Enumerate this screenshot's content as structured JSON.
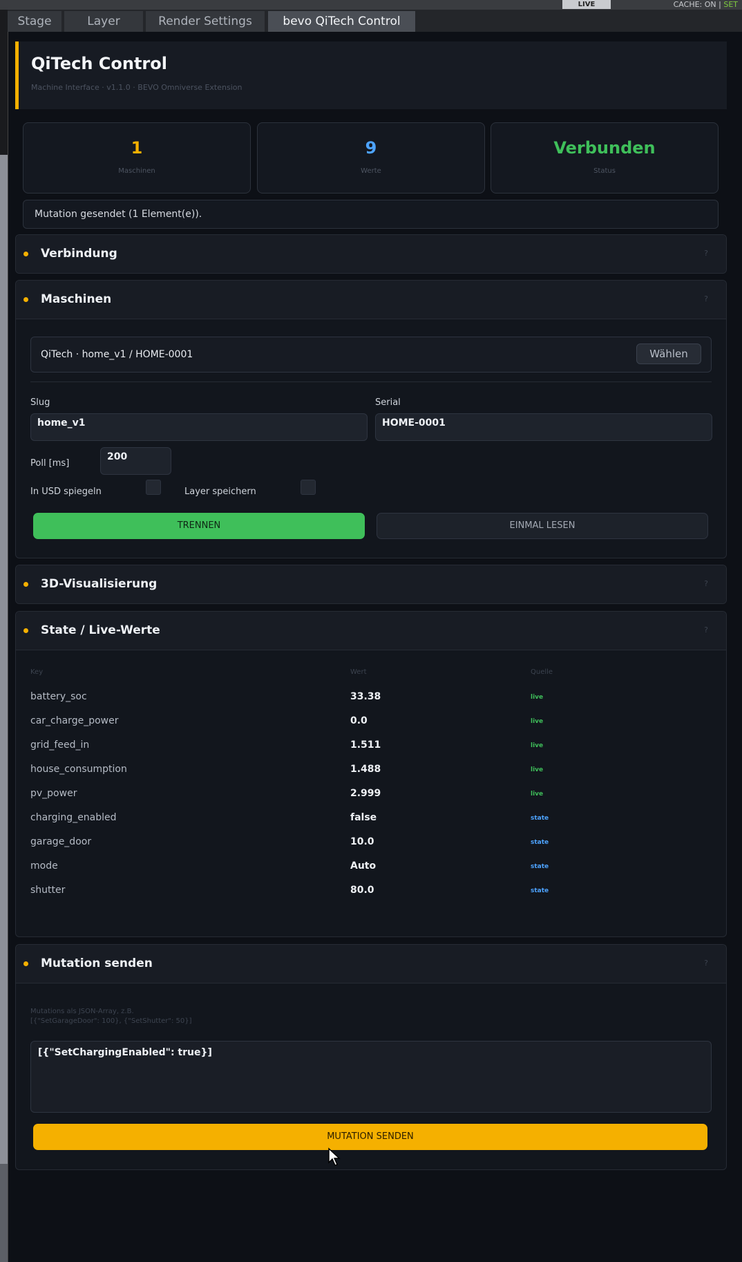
{
  "topbar": {
    "live_label": "LIVE",
    "cache_label": "CACHE: ON",
    "cache_suffix": "SET"
  },
  "tabs": [
    {
      "label": "Stage"
    },
    {
      "label": "Layer"
    },
    {
      "label": "Render Settings"
    },
    {
      "label": "bevo QiTech Control",
      "active": true
    }
  ],
  "header": {
    "title": "QiTech Control",
    "subtitle": "Machine Interface · v1.1.0 · BEVO Omniverse Extension"
  },
  "stats": [
    {
      "value": "1",
      "label": "Maschinen",
      "color": "#f5b000"
    },
    {
      "value": "9",
      "label": "Werte",
      "color": "#4da3ff"
    },
    {
      "value": "Verbunden",
      "label": "Status",
      "color": "#3fbf5a"
    }
  ],
  "message": "Mutation gesendet (1 Element(e)).",
  "sections": {
    "connection": {
      "title": "Verbindung",
      "help": "?"
    },
    "machines": {
      "title": "Maschinen",
      "help": "?",
      "machine_label": "QiTech · home_v1 / HOME-0001",
      "select_button": "Wählen",
      "slug_label": "Slug",
      "slug_value": "home_v1",
      "serial_label": "Serial",
      "serial_value": "HOME-0001",
      "poll_label": "Poll [ms]",
      "poll_value": "200",
      "mirror_label": "In USD spiegeln",
      "save_layer_label": "Layer speichern",
      "disconnect_button": "TRENNEN",
      "read_once_button": "EINMAL LESEN"
    },
    "visualization": {
      "title": "3D-Visualisierung",
      "help": "?"
    },
    "state": {
      "title": "State / Live-Werte",
      "help": "?",
      "headers": {
        "key": "Key",
        "value": "Wert",
        "source": "Quelle"
      },
      "rows": [
        {
          "key": "battery_soc",
          "value": "33.38",
          "source": "live"
        },
        {
          "key": "car_charge_power",
          "value": "0.0",
          "source": "live"
        },
        {
          "key": "grid_feed_in",
          "value": "1.511",
          "source": "live"
        },
        {
          "key": "house_consumption",
          "value": "1.488",
          "source": "live"
        },
        {
          "key": "pv_power",
          "value": "2.999",
          "source": "live"
        },
        {
          "key": "charging_enabled",
          "value": "false",
          "source": "state"
        },
        {
          "key": "garage_door",
          "value": "10.0",
          "source": "state"
        },
        {
          "key": "mode",
          "value": "Auto",
          "source": "state"
        },
        {
          "key": "shutter",
          "value": "80.0",
          "source": "state"
        }
      ]
    },
    "mutation": {
      "title": "Mutation senden",
      "help": "?",
      "hint_line1": "Mutations als JSON-Array, z.B.",
      "hint_line2": "[{\"SetGarageDoor\": 100}, {\"SetShutter\": 50}]",
      "textarea_value": "[{\"SetChargingEnabled\": true}]",
      "send_button": "MUTATION SENDEN"
    }
  },
  "colors": {
    "accent": "#f5b000",
    "success": "#3fbf5a",
    "info": "#4da3ff"
  }
}
